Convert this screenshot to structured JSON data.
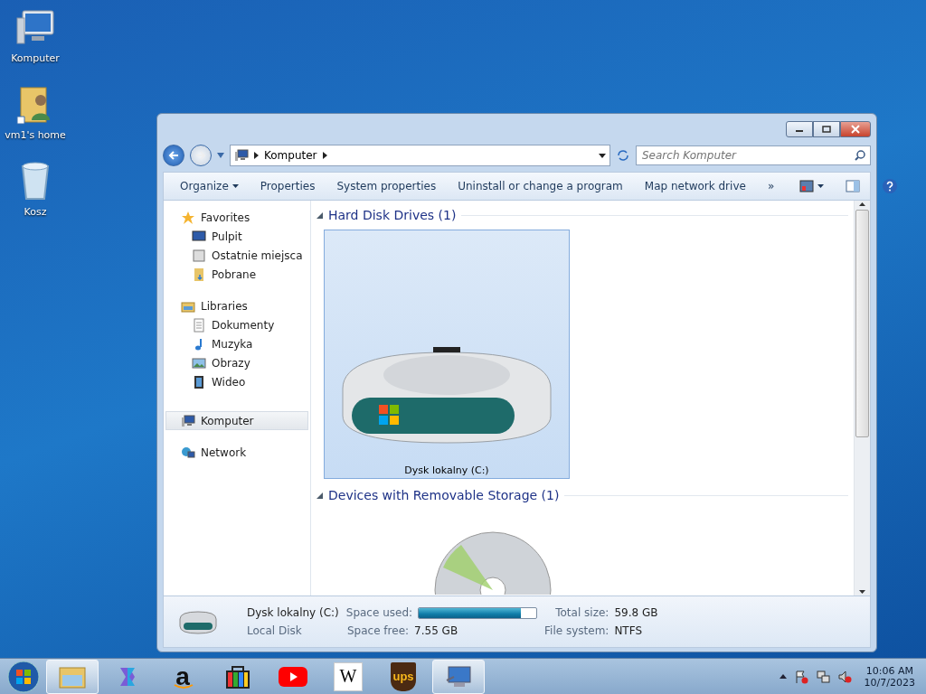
{
  "desktop_icons": [
    {
      "label": "Komputer",
      "kind": "computer"
    },
    {
      "label": "vm1's home",
      "kind": "user"
    },
    {
      "label": "Kosz",
      "kind": "bin"
    }
  ],
  "window": {
    "address": {
      "crumbs": [
        "Komputer"
      ]
    },
    "search": {
      "placeholder": "Search Komputer"
    },
    "toolbar": [
      {
        "label": "Organize",
        "dropdown": true
      },
      {
        "label": "Properties",
        "dropdown": false
      },
      {
        "label": "System properties",
        "dropdown": false
      },
      {
        "label": "Uninstall or change a program",
        "dropdown": false
      },
      {
        "label": "Map network drive",
        "dropdown": false
      },
      {
        "label": "»",
        "dropdown": false
      }
    ],
    "nav": [
      {
        "label": "Favorites",
        "kind": "star",
        "selected": false,
        "children": [
          {
            "label": "Pulpit",
            "kind": "desktop",
            "selected": false
          },
          {
            "label": "Ostatnie miejsca",
            "kind": "recent",
            "selected": false
          },
          {
            "label": "Pobrane",
            "kind": "download",
            "selected": false
          }
        ]
      },
      {
        "label": "Libraries",
        "kind": "library",
        "selected": false,
        "children": [
          {
            "label": "Dokumenty",
            "kind": "document",
            "selected": false
          },
          {
            "label": "Muzyka",
            "kind": "music",
            "selected": false
          },
          {
            "label": "Obrazy",
            "kind": "picture",
            "selected": false
          },
          {
            "label": "Wideo",
            "kind": "video",
            "selected": false
          }
        ]
      },
      {
        "label": "Komputer",
        "kind": "computer",
        "selected": true
      },
      {
        "label": "Network",
        "kind": "network",
        "selected": false
      }
    ],
    "groups": [
      {
        "title": "Hard Disk Drives (1)",
        "expanded": true,
        "items": [
          {
            "label": "Dysk lokalny (C:)",
            "kind": "disk",
            "selected": true
          }
        ]
      },
      {
        "title": "Devices with Removable Storage (1)",
        "expanded": true,
        "items": [
          {
            "kind": "cd"
          }
        ]
      }
    ],
    "details": {
      "name": "Dysk lokalny (C:)",
      "type": "Local Disk",
      "used_label": "Space used:",
      "level": 0.87,
      "free_label": "Space free:",
      "free": "7.55 GB",
      "total_label": "Total size:",
      "total": "59.8 GB",
      "fs_label": "File system:",
      "fs": "NTFS"
    }
  },
  "taskbar": {
    "apps": [
      {
        "kind": "explorer",
        "selected": true
      },
      {
        "kind": "copilot",
        "selected": false
      },
      {
        "kind": "amazon",
        "label": "a",
        "selected": false
      },
      {
        "kind": "store",
        "selected": false
      },
      {
        "kind": "youtube",
        "selected": false
      },
      {
        "kind": "wiki",
        "label": "W",
        "selected": false
      },
      {
        "kind": "ups",
        "label": "ups",
        "selected": false
      },
      {
        "kind": "remote",
        "selected": true
      }
    ],
    "clock": {
      "time": "10:06 AM",
      "date": "10/7/2023"
    }
  }
}
